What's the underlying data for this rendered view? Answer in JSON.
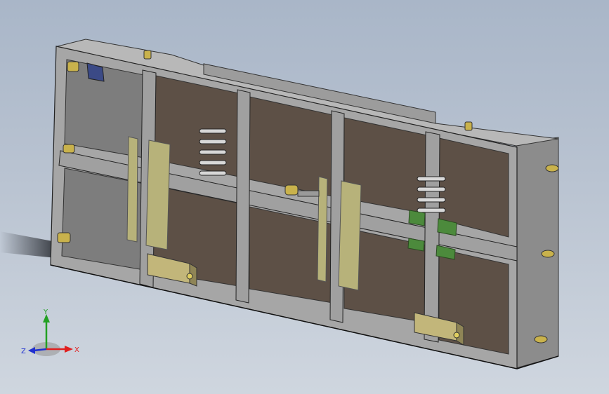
{
  "viewport": {
    "background_top": "#a9b6c8",
    "background_bottom": "#cfd6df"
  },
  "model": {
    "frame_color": "#a6a6a6",
    "frame_shadow": "#6f6f6f",
    "panel_color": "#5d5046",
    "bracket_color": "#b7b27a",
    "green_color": "#4c8a3c",
    "brass_color": "#c9b24c"
  },
  "triad": {
    "x_label": "X",
    "y_label": "Y",
    "z_label": "Z",
    "x_color": "#e02020",
    "y_color": "#22a022",
    "z_color": "#2030d0"
  }
}
